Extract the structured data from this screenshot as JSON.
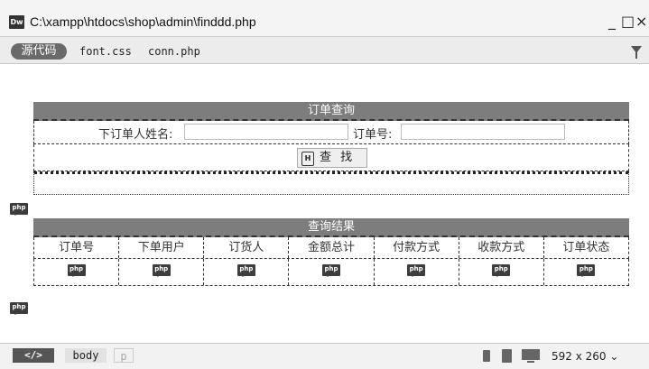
{
  "window": {
    "app_icon": "Dw",
    "title": "C:\\xampp\\htdocs\\shop\\admin\\finddd.php",
    "minimize": "_",
    "maximize": "□",
    "close": "×"
  },
  "filebar": {
    "source_button": "源代码",
    "related_files": [
      "font.css",
      "conn.php"
    ]
  },
  "search_form": {
    "header": "订单查询",
    "name_label": "下订单人姓名:",
    "name_value": "",
    "order_no_label": "订单号:",
    "order_no_value": "",
    "find_button": "查 找",
    "find_button_icon": "H"
  },
  "php_marker": "php",
  "results": {
    "header": "查询结果",
    "columns": [
      "订单号",
      "下单用户",
      "订货人",
      "金额总计",
      "付款方式",
      "收款方式",
      "订单状态"
    ],
    "row_marker": "php"
  },
  "statusbar": {
    "code_tag": "</>",
    "breadcrumb": [
      "body",
      "p"
    ],
    "window_size": "592 x 260"
  }
}
